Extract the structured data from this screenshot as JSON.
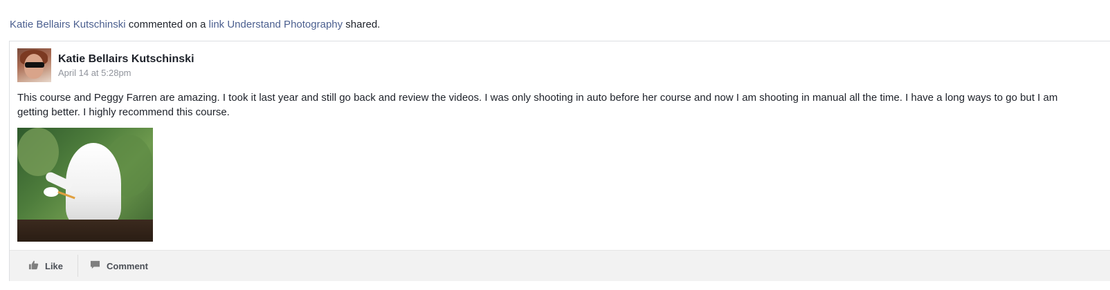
{
  "story": {
    "actor": "Katie Bellairs Kutschinski",
    "verb": "commented on a",
    "object_link": "link",
    "target": "Understand Photography",
    "suffix": "shared."
  },
  "post": {
    "author": "Katie Bellairs Kutschinski",
    "timestamp": "April 14 at 5:28pm",
    "text": "This course and Peggy Farren are amazing. I took it last year and still go back and review the videos. I was only shooting in auto before her course and now I am shooting in manual all the time. I have a long ways to go but I am getting better. I highly recommend this course.",
    "avatar_icon": "profile-photo",
    "photo_icon": "egret-photo"
  },
  "actions": {
    "like_label": "Like",
    "like_icon": "thumbs-up-icon",
    "comment_label": "Comment",
    "comment_icon": "speech-bubble-icon"
  },
  "colors": {
    "link": "#4b5f8f",
    "text": "#1d2129",
    "meta": "#90949c",
    "action_bar": "#f2f2f2"
  }
}
